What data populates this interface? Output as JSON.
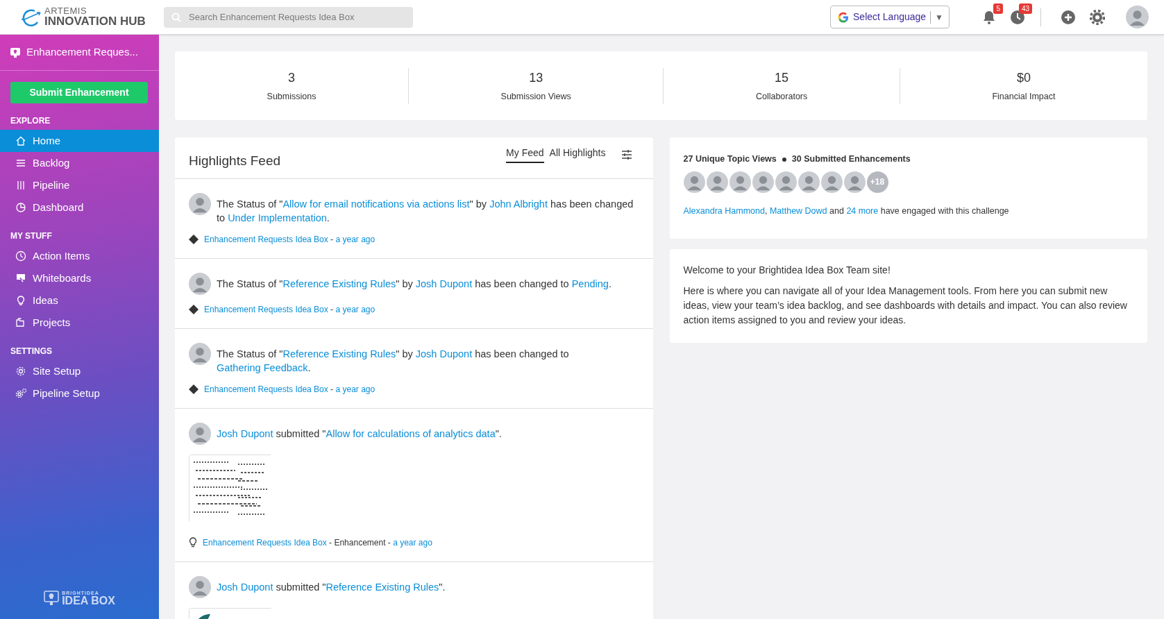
{
  "topbar": {
    "logo": {
      "line_1": "ARTEMIS",
      "line_2": "INNOVATION HUB"
    },
    "search": {
      "placeholder": "Search Enhancement Requests Idea Box"
    },
    "language": {
      "label": "Select Language",
      "caret": "▼"
    },
    "notifications": {
      "count": "5"
    },
    "activity": {
      "count": "43"
    }
  },
  "sidebar": {
    "title": "Enhancement Reques...",
    "submit_button": "Submit Enhancement",
    "sections": [
      {
        "heading": "EXPLORE",
        "items": [
          {
            "label": "Home",
            "kind": "home",
            "selected": true
          },
          {
            "label": "Backlog",
            "kind": "list",
            "selected": false
          },
          {
            "label": "Pipeline",
            "kind": "pipeline",
            "selected": false
          },
          {
            "label": "Dashboard",
            "kind": "pie",
            "selected": false
          }
        ]
      },
      {
        "heading": "MY STUFF",
        "items": [
          {
            "label": "Action Items",
            "kind": "clock",
            "selected": false
          },
          {
            "label": "Whiteboards",
            "kind": "whiteboard",
            "selected": false
          },
          {
            "label": "Ideas",
            "kind": "bulb",
            "selected": false
          },
          {
            "label": "Projects",
            "kind": "folders",
            "selected": false
          }
        ]
      },
      {
        "heading": "SETTINGS",
        "items": [
          {
            "label": "Site Setup",
            "kind": "gear",
            "selected": false
          },
          {
            "label": "Pipeline Setup",
            "kind": "gears",
            "selected": false
          }
        ]
      }
    ],
    "footer_logo": {
      "line_1": "BRIGHTIDEA",
      "line_2": "IDEA BOX"
    }
  },
  "stats": [
    {
      "value": "3",
      "label": "Submissions"
    },
    {
      "value": "13",
      "label": "Submission Views"
    },
    {
      "value": "15",
      "label": "Collaborators"
    },
    {
      "value": "$0",
      "label": "Financial Impact"
    }
  ],
  "feed": {
    "title": "Highlights Feed",
    "tabs": [
      {
        "label": "My Feed",
        "selected": true
      },
      {
        "label": "All Highlights",
        "selected": false
      }
    ],
    "items": [
      {
        "kind": "status",
        "sentence": [
          {
            "text": "The Status of \"",
            "link": false
          },
          {
            "text": "Allow for email notifications via actions list",
            "link": true
          },
          {
            "text": "\" by ",
            "link": false
          },
          {
            "text": "John Albright",
            "link": true
          },
          {
            "text": " has been changed to ",
            "link": false
          },
          {
            "text": "Under Implementation",
            "link": true
          },
          {
            "text": ".",
            "link": false
          }
        ],
        "meta": [
          {
            "text": "Enhancement Requests Idea Box",
            "link": true
          },
          {
            "text": " - ",
            "link": false
          },
          {
            "text": "a year ago",
            "link": true
          }
        ]
      },
      {
        "kind": "status",
        "sentence": [
          {
            "text": "The Status of \"",
            "link": false
          },
          {
            "text": "Reference Existing Rules",
            "link": true
          },
          {
            "text": "\" by ",
            "link": false
          },
          {
            "text": "Josh Dupont",
            "link": true
          },
          {
            "text": " has been changed to ",
            "link": false
          },
          {
            "text": "Pending",
            "link": true
          },
          {
            "text": ".",
            "link": false
          }
        ],
        "meta": [
          {
            "text": "Enhancement Requests Idea Box",
            "link": true
          },
          {
            "text": " - ",
            "link": false
          },
          {
            "text": "a year ago",
            "link": true
          }
        ]
      },
      {
        "kind": "status",
        "sentence": [
          {
            "text": "The Status of \"",
            "link": false
          },
          {
            "text": "Reference Existing Rules",
            "link": true
          },
          {
            "text": "\" by ",
            "link": false
          },
          {
            "text": "Josh Dupont",
            "link": true
          },
          {
            "text": " has been changed to ",
            "link": false
          },
          {
            "text": "Gathering Feedback",
            "link": true
          },
          {
            "text": ".",
            "link": false
          }
        ],
        "meta": [
          {
            "text": "Enhancement Requests Idea Box",
            "link": true
          },
          {
            "text": " - ",
            "link": false
          },
          {
            "text": "a year ago",
            "link": true
          }
        ]
      },
      {
        "kind": "submission",
        "sentence": [
          {
            "text": "Josh Dupont",
            "link": true
          },
          {
            "text": " submitted \"",
            "link": false
          },
          {
            "text": "Allow for calculations of analytics data",
            "link": true
          },
          {
            "text": "\".",
            "link": false
          }
        ],
        "picture": {
          "kind": "picture"
        },
        "meta": [
          {
            "text": "Enhancement Requests Idea Box",
            "link": true
          },
          {
            "text": " - Enhancement - ",
            "link": false
          },
          {
            "text": "a year ago",
            "link": true
          }
        ]
      },
      {
        "kind": "submission",
        "sentence": [
          {
            "text": "Josh Dupont",
            "link": true
          },
          {
            "text": " submitted \"",
            "link": false
          },
          {
            "text": "Reference Existing Rules",
            "link": true
          },
          {
            "text": "\".",
            "link": false
          }
        ],
        "picture": {
          "kind": "picture"
        }
      }
    ]
  },
  "engagement": {
    "stats": [
      "27 Unique Topic Views",
      "30 Submitted Enhancements"
    ],
    "avatars": [
      {
        "kind": "avatar"
      },
      {
        "kind": "avatar"
      },
      {
        "kind": "avatar"
      },
      {
        "kind": "avatar"
      },
      {
        "kind": "avatar"
      },
      {
        "kind": "avatar"
      },
      {
        "kind": "avatar"
      },
      {
        "kind": "avatar"
      }
    ],
    "more": "+18",
    "sentence": [
      {
        "text": "Alexandra Hammond",
        "link": true
      },
      {
        "text": ", ",
        "link": false
      },
      {
        "text": "Matthew Dowd",
        "link": true
      },
      {
        "text": " and ",
        "link": false
      },
      {
        "text": "24 more",
        "link": true
      },
      {
        "text": " have engaged with this challenge",
        "link": false
      }
    ]
  },
  "welcome": {
    "title": "Welcome to your Brightidea Idea Box Team site!",
    "body": "Here is where you can navigate all of your Idea Management tools. From here you can submit new ideas, view your team’s idea backlog, and see dashboards with details and impact. You can also review action items assigned to you and review your ideas."
  }
}
